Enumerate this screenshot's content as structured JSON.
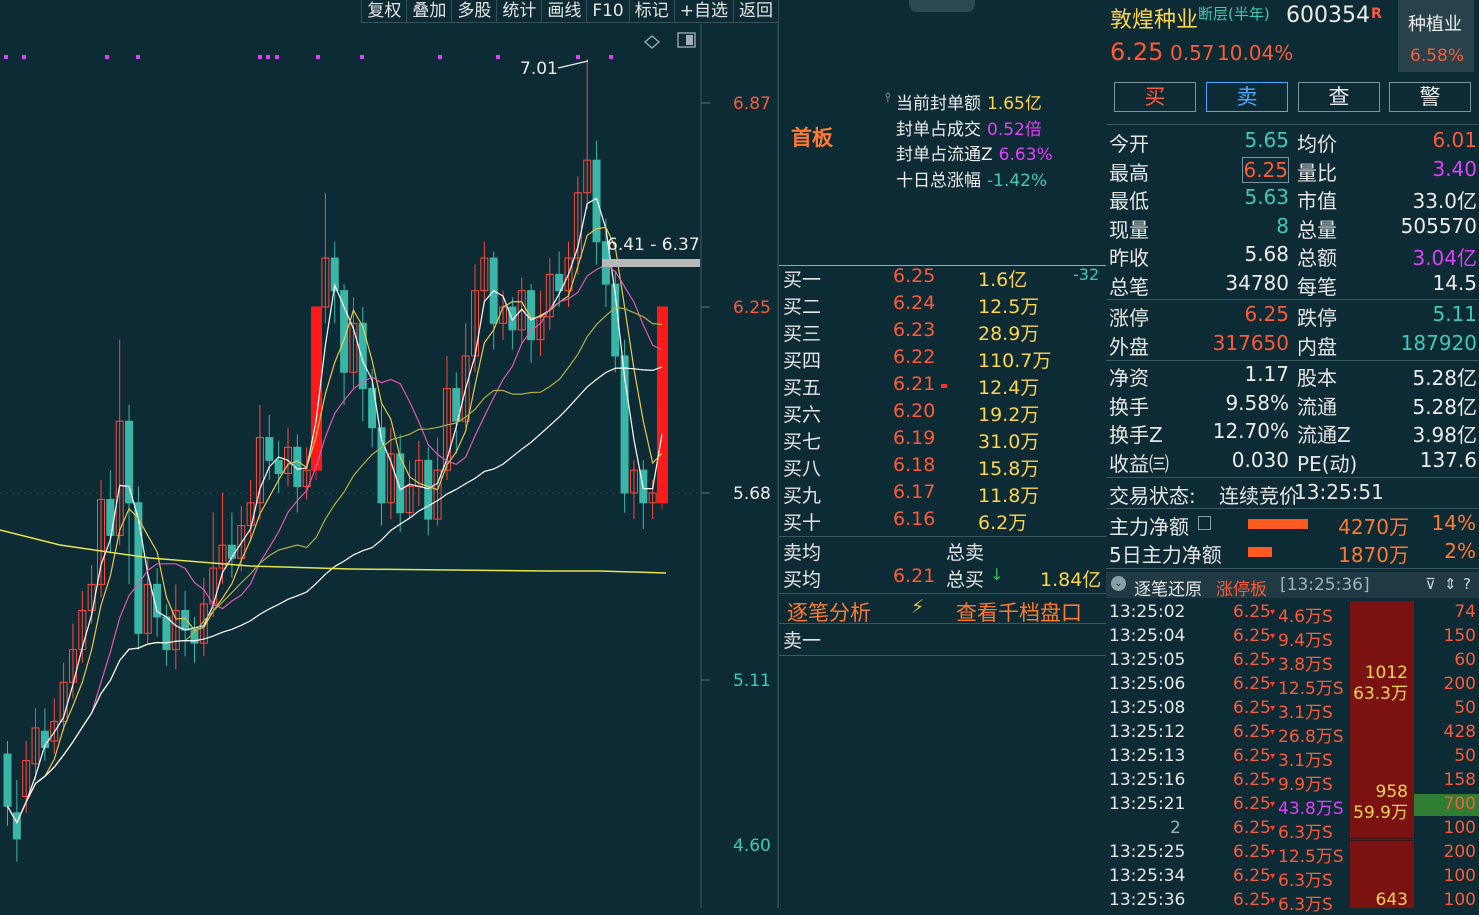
{
  "toolbar": {
    "buttons": [
      "复权",
      "叠加",
      "多股",
      "统计",
      "画线",
      "F10",
      "标记",
      "+自选",
      "返回"
    ]
  },
  "chart_data": {
    "type": "candlestick",
    "price_labels": [
      "6.87",
      "6.25",
      "5.68",
      "5.11",
      "4.60"
    ],
    "annotation_high": "7.01",
    "range_label": "6.41 - 6.37"
  },
  "seal": {
    "badge": "首板",
    "rows": [
      {
        "label": "当前封单额",
        "value": "1.65亿",
        "color": "#ffd54a"
      },
      {
        "label": "封单占成交",
        "value": "0.52倍",
        "color": "#e040fb"
      },
      {
        "label": "封单占流通Z",
        "value": "6.63%",
        "color": "#e040fb"
      },
      {
        "label": "十日总涨幅",
        "value": "-1.42%",
        "color": "#3ec9b8"
      }
    ]
  },
  "bids": [
    {
      "label": "买一",
      "price": "6.25",
      "vol": "1.6亿",
      "extra": "-32"
    },
    {
      "label": "买二",
      "price": "6.24",
      "vol": "12.5万",
      "extra": ""
    },
    {
      "label": "买三",
      "price": "6.23",
      "vol": "28.9万",
      "extra": ""
    },
    {
      "label": "买四",
      "price": "6.22",
      "vol": "110.7万",
      "extra": ""
    },
    {
      "label": "买五",
      "price": "6.21",
      "vol": "12.4万",
      "extra": ""
    },
    {
      "label": "买六",
      "price": "6.20",
      "vol": "19.2万",
      "extra": ""
    },
    {
      "label": "买七",
      "price": "6.19",
      "vol": "31.0万",
      "extra": ""
    },
    {
      "label": "买八",
      "price": "6.18",
      "vol": "15.8万",
      "extra": ""
    },
    {
      "label": "买九",
      "price": "6.17",
      "vol": "11.8万",
      "extra": ""
    },
    {
      "label": "买十",
      "price": "6.16",
      "vol": "6.2万",
      "extra": ""
    }
  ],
  "avg": {
    "sell_avg_label": "卖均",
    "sell_total_label": "总卖",
    "buy_avg_label": "买均",
    "buy_avg": "6.21",
    "buy_total_label": "总买",
    "buy_total": "1.84亿"
  },
  "links": {
    "tick_analysis": "逐笔分析",
    "depth": "查看千档盘口"
  },
  "ask1_label": "卖一",
  "stock": {
    "name": "敦煌种业",
    "layer": "断层(半年)",
    "code": "600354",
    "r_mark": "R",
    "price": "6.25",
    "change": "0.57",
    "pct": "10.04%",
    "sector": "种植业",
    "sector_pct": "6.58%"
  },
  "actions": [
    "买",
    "卖",
    "查",
    "警"
  ],
  "info": [
    [
      {
        "l": "今开",
        "v": "5.65",
        "c": "green"
      },
      {
        "l": "均价",
        "v": "6.01",
        "c": "red"
      }
    ],
    [
      {
        "l": "最高",
        "v": "6.25",
        "c": "red"
      },
      {
        "l": "量比",
        "v": "3.40",
        "c": "mag"
      }
    ],
    [
      {
        "l": "最低",
        "v": "5.63",
        "c": "green"
      },
      {
        "l": "市值",
        "v": "33.0亿",
        "c": "white"
      }
    ],
    [
      {
        "l": "现量",
        "v": "8",
        "c": "green"
      },
      {
        "l": "总量",
        "v": "505570",
        "c": "white"
      }
    ],
    [
      {
        "l": "昨收",
        "v": "5.68",
        "c": "white"
      },
      {
        "l": "总额",
        "v": "3.04亿",
        "c": "mag"
      }
    ],
    [
      {
        "l": "总笔",
        "v": "34780",
        "c": "white"
      },
      {
        "l": "每笔",
        "v": "14.5",
        "c": "white"
      }
    ]
  ],
  "info2": [
    [
      {
        "l": "涨停",
        "v": "6.25",
        "c": "red"
      },
      {
        "l": "跌停",
        "v": "5.11",
        "c": "green"
      }
    ],
    [
      {
        "l": "外盘",
        "v": "317650",
        "c": "red"
      },
      {
        "l": "内盘",
        "v": "187920",
        "c": "green"
      }
    ]
  ],
  "info3": [
    [
      {
        "l": "净资",
        "v": "1.17",
        "c": "white"
      },
      {
        "l": "股本",
        "v": "5.28亿",
        "c": "white"
      }
    ],
    [
      {
        "l": "换手",
        "v": "9.58%",
        "c": "white"
      },
      {
        "l": "流通",
        "v": "5.28亿",
        "c": "white"
      }
    ],
    [
      {
        "l": "换手Z",
        "v": "12.70%",
        "c": "white"
      },
      {
        "l": "流通Z",
        "v": "3.98亿",
        "c": "white"
      }
    ],
    [
      {
        "l": "收益㈢",
        "v": "0.030",
        "c": "white"
      },
      {
        "l": "PE(动)",
        "v": "137.6",
        "c": "white"
      }
    ]
  ],
  "trade_status": {
    "label": "交易状态:",
    "status": "连续竞价",
    "time": "13:25:51"
  },
  "main_flow": [
    {
      "label": "主力净额",
      "value": "4270万",
      "pct": "14%",
      "bar": 0.27
    },
    {
      "label": "5日主力净额",
      "value": "1870万",
      "pct": "2%",
      "bar": 0.11
    }
  ],
  "tick_header": {
    "title": "逐笔还原",
    "board": "涨停板",
    "time": "[13:25:36]"
  },
  "ticks": [
    {
      "t": "13:25:02",
      "p": "6.25",
      "v": "4.6万S",
      "c": "74",
      "vc": "red"
    },
    {
      "t": "13:25:04",
      "p": "6.25",
      "v": "9.4万S",
      "c": "150",
      "vc": "red"
    },
    {
      "t": "13:25:05",
      "p": "6.25",
      "v": "3.8万S",
      "c": "60",
      "vc": "red"
    },
    {
      "t": "13:25:06",
      "p": "6.25",
      "v": "12.5万S",
      "c": "200",
      "vc": "red"
    },
    {
      "t": "13:25:08",
      "p": "6.25",
      "v": "3.1万S",
      "c": "50",
      "vc": "red"
    },
    {
      "t": "13:25:12",
      "p": "6.25",
      "v": "26.8万S",
      "c": "428",
      "vc": "red"
    },
    {
      "t": "13:25:13",
      "p": "6.25",
      "v": "3.1万S",
      "c": "50",
      "vc": "red"
    },
    {
      "t": "13:25:16",
      "p": "6.25",
      "v": "9.9万S",
      "c": "158",
      "vc": "red"
    },
    {
      "t": "13:25:21",
      "p": "6.25",
      "v": "43.8万S",
      "c": "700",
      "vc": "mag"
    },
    {
      "t": "2",
      "p": "6.25",
      "v": "6.3万S",
      "c": "100",
      "vc": "red"
    },
    {
      "t": "13:25:25",
      "p": "6.25",
      "v": "12.5万S",
      "c": "200",
      "vc": "red"
    },
    {
      "t": "13:25:34",
      "p": "6.25",
      "v": "6.3万S",
      "c": "100",
      "vc": "red"
    },
    {
      "t": "13:25:36",
      "p": "6.25",
      "v": "6.3万S",
      "c": "100",
      "vc": "red"
    }
  ],
  "tick_groups": [
    {
      "n": "1012",
      "amt": "63.3万"
    },
    {
      "n": "958",
      "amt": "59.9万"
    },
    {
      "n": "643",
      "amt": ""
    }
  ]
}
